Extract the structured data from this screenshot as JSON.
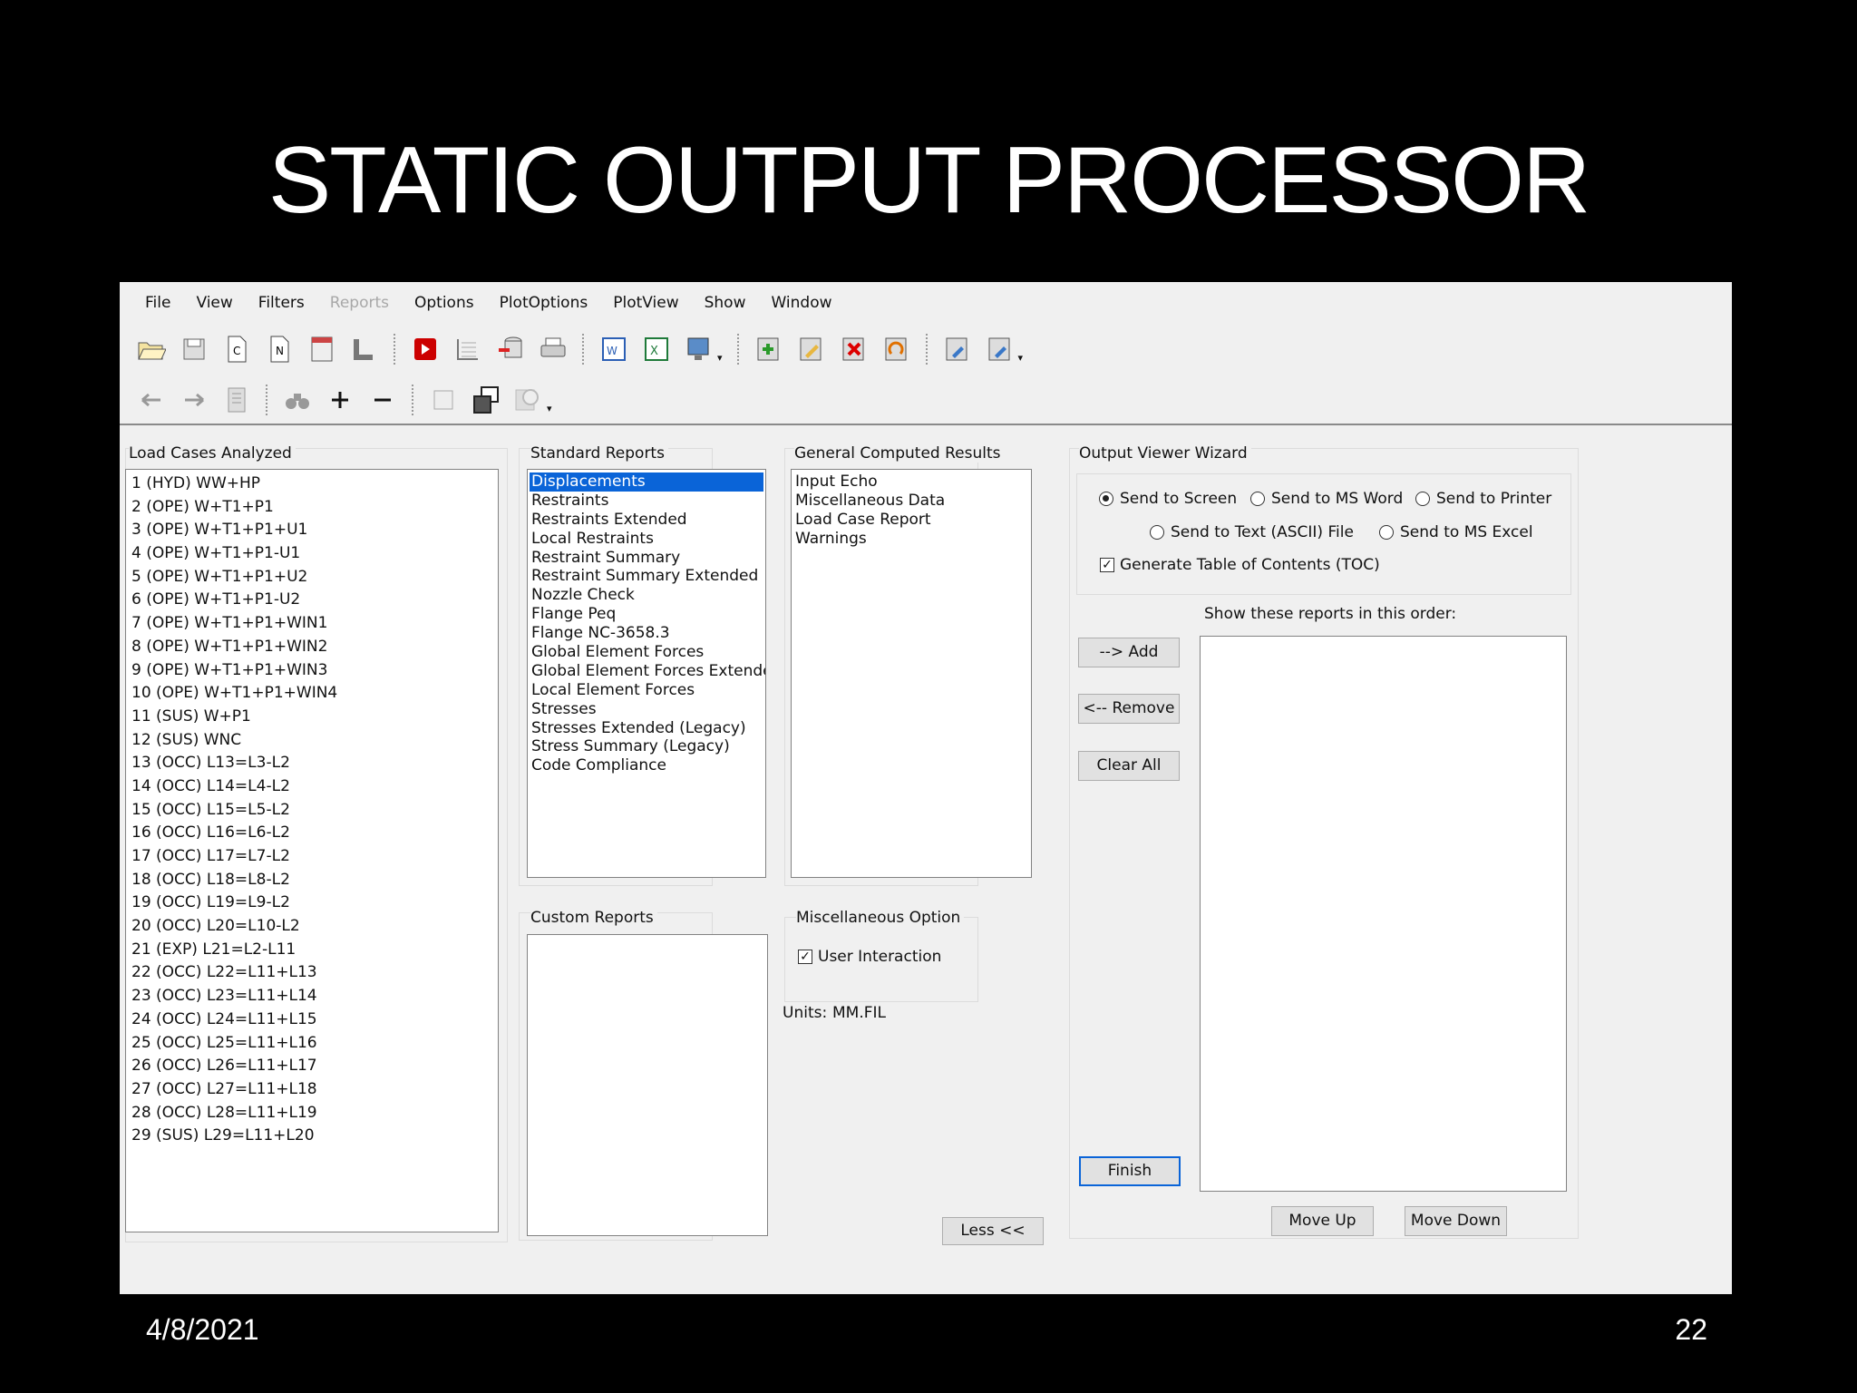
{
  "slide": {
    "title": "STATIC OUTPUT PROCESSOR",
    "date": "4/8/2021",
    "page_number": "22"
  },
  "menu": [
    "File",
    "View",
    "Filters",
    "Reports",
    "Options",
    "PlotOptions",
    "PlotView",
    "Show",
    "Window"
  ],
  "menu_disabled": [
    "Reports"
  ],
  "load_cases": {
    "label": "Load Cases Analyzed",
    "items": [
      "1 (HYD) WW+HP",
      "2 (OPE) W+T1+P1",
      "3 (OPE) W+T1+P1+U1",
      "4 (OPE) W+T1+P1-U1",
      "5 (OPE) W+T1+P1+U2",
      "6 (OPE) W+T1+P1-U2",
      "7 (OPE) W+T1+P1+WIN1",
      "8 (OPE) W+T1+P1+WIN2",
      "9 (OPE) W+T1+P1+WIN3",
      "10 (OPE) W+T1+P1+WIN4",
      "11 (SUS) W+P1",
      "12 (SUS) WNC",
      "13 (OCC) L13=L3-L2",
      "14 (OCC) L14=L4-L2",
      "15 (OCC) L15=L5-L2",
      "16 (OCC) L16=L6-L2",
      "17 (OCC) L17=L7-L2",
      "18 (OCC) L18=L8-L2",
      "19 (OCC) L19=L9-L2",
      "20 (OCC) L20=L10-L2",
      "21 (EXP) L21=L2-L11",
      "22 (OCC) L22=L11+L13",
      "23 (OCC) L23=L11+L14",
      "24 (OCC) L24=L11+L15",
      "25 (OCC) L25=L11+L16",
      "26 (OCC) L26=L11+L17",
      "27 (OCC) L27=L11+L18",
      "28 (OCC) L28=L11+L19",
      "29 (SUS) L29=L11+L20"
    ]
  },
  "standard_reports": {
    "label": "Standard Reports",
    "items": [
      "Displacements",
      "Restraints",
      "Restraints Extended",
      "Local Restraints",
      "Restraint Summary",
      "Restraint Summary Extended",
      "Nozzle Check",
      "Flange Peq",
      "Flange NC-3658.3",
      "Global Element Forces",
      "Global Element Forces Extended",
      "Local Element Forces",
      "Stresses",
      "Stresses Extended (Legacy)",
      "Stress Summary (Legacy)",
      "Code Compliance"
    ],
    "selected_index": 0
  },
  "general_results": {
    "label": "General Computed Results",
    "items": [
      "Input Echo",
      "Miscellaneous Data",
      "Load Case Report",
      "Warnings"
    ]
  },
  "custom_reports": {
    "label": "Custom Reports"
  },
  "misc": {
    "label": "Miscellaneous Option",
    "user_interaction": "User Interaction",
    "units_label": "Units:",
    "units_value": "MM.FIL"
  },
  "wizard": {
    "label": "Output Viewer Wizard",
    "send_screen": "Send to Screen",
    "send_word": "Send to MS Word",
    "send_printer": "Send to Printer",
    "send_text": "Send to Text (ASCII) File",
    "send_excel": "Send to MS Excel",
    "toc": "Generate Table of Contents (TOC)",
    "order_label": "Show these reports in this order:",
    "add": "--> Add",
    "remove": "<-- Remove",
    "clear_all": "Clear All",
    "finish": "Finish",
    "move_up": "Move Up",
    "move_down": "Move Down"
  },
  "less_button": "Less <<"
}
